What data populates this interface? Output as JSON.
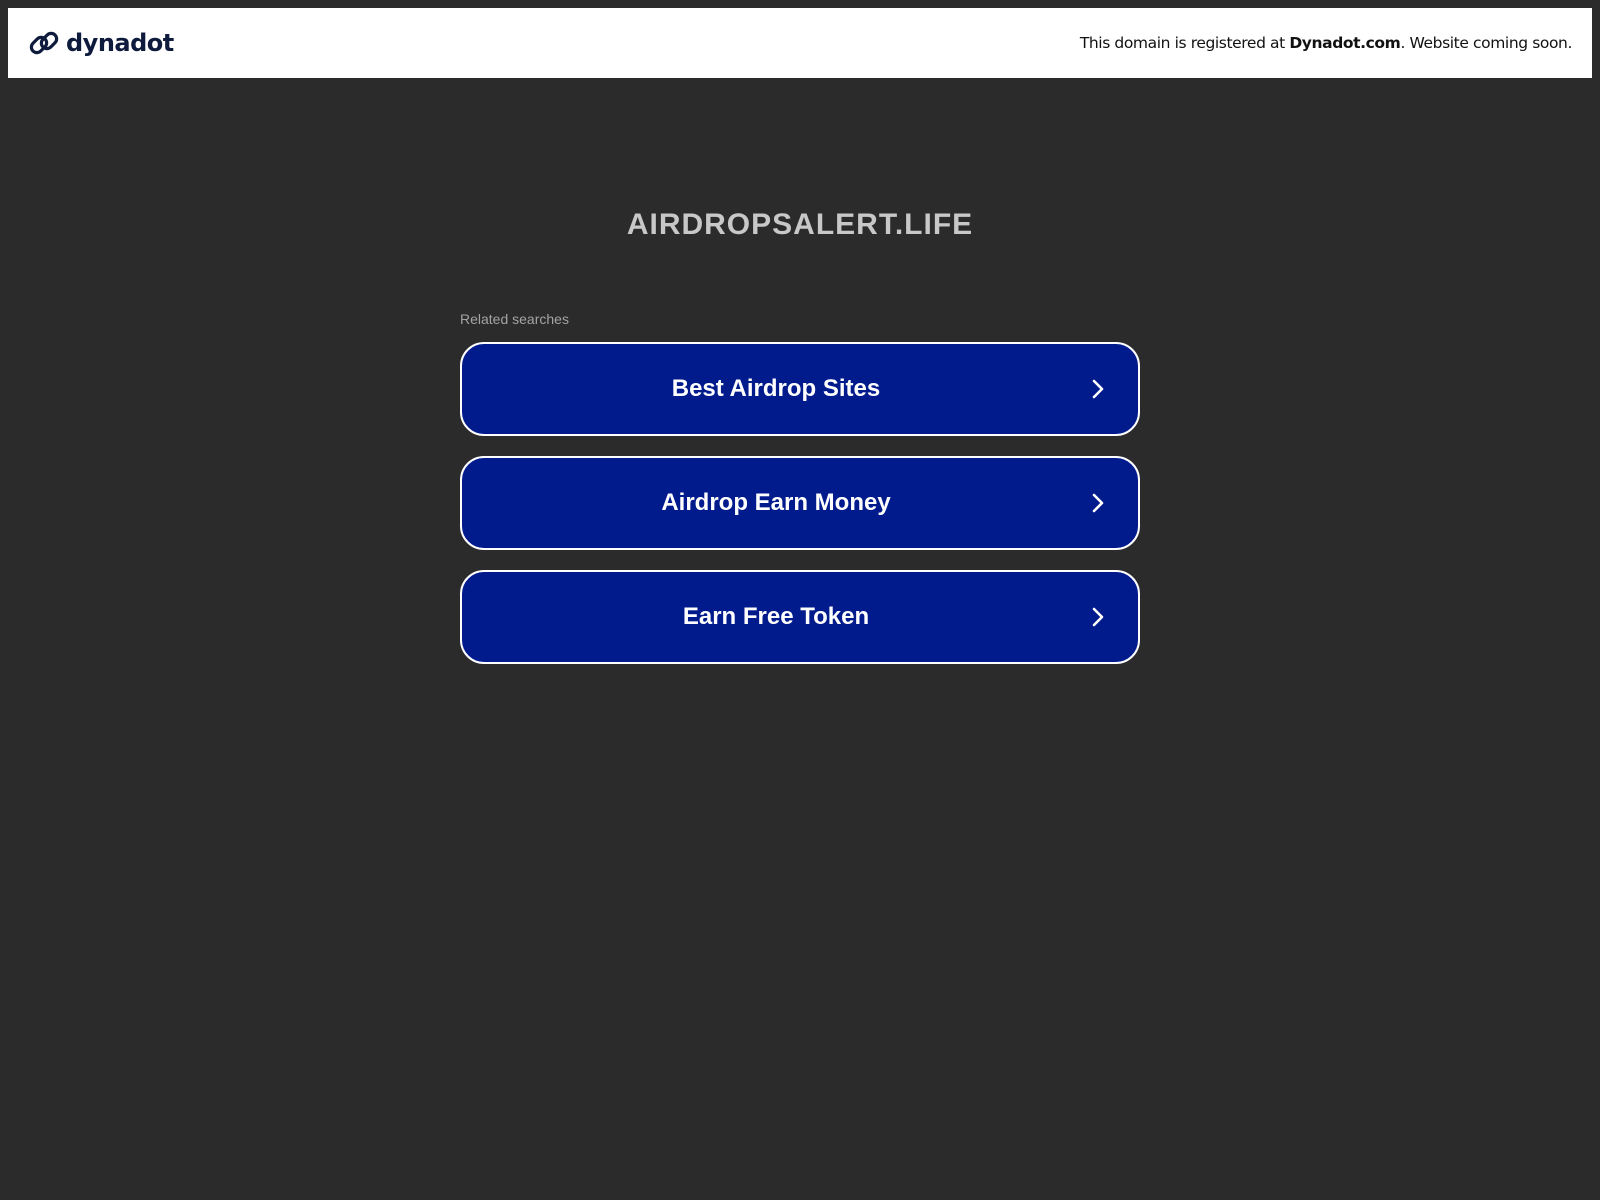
{
  "header": {
    "brand_name": "dynadot",
    "brand_icon": "link-icon",
    "notice_prefix": "This domain is registered at ",
    "notice_registrar": "Dynadot.com",
    "notice_suffix": ". Website coming soon."
  },
  "main": {
    "domain": "AIRDROPSALERT.LIFE",
    "related_label": "Related searches",
    "results": [
      {
        "label": "Best Airdrop Sites",
        "icon": "chevron-right-icon"
      },
      {
        "label": "Airdrop Earn Money",
        "icon": "chevron-right-icon"
      },
      {
        "label": "Earn Free Token",
        "icon": "chevron-right-icon"
      }
    ]
  },
  "colors": {
    "page_background": "#2b2b2b",
    "header_background": "#ffffff",
    "button_background": "#011a8c",
    "button_border": "#ffffff",
    "brand_text": "#0f1b3c",
    "domain_text": "#c8c8c8",
    "related_text": "#a3a3a3"
  }
}
